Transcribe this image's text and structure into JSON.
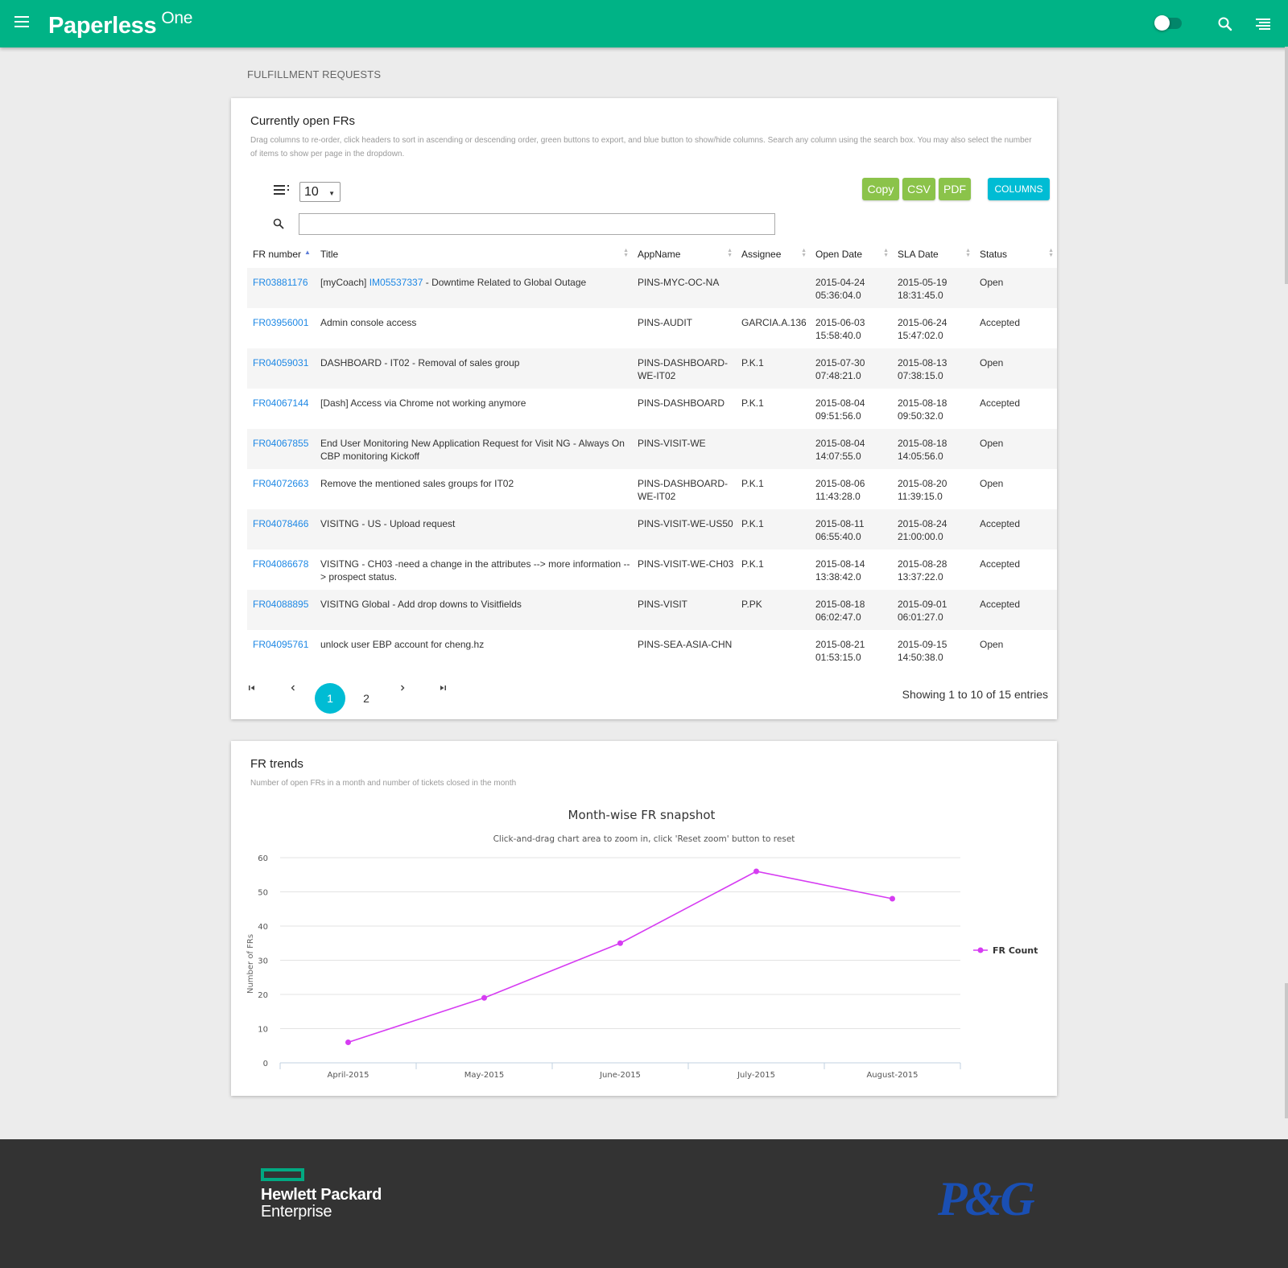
{
  "header": {
    "brand": "Paperless",
    "brand_suffix": "One",
    "icons": [
      "menu-icon",
      "toggle-switch",
      "search-icon",
      "menu-right-icon"
    ]
  },
  "page_title": "FULFILLMENT REQUESTS",
  "open_frs": {
    "title": "Currently open FRs",
    "description": "Drag columns to re-order, click headers to sort in ascending or descending order, green buttons to export, and blue button to show/hide columns. Search any column using the search box. You may also select the number of items to show per page in the dropdown.",
    "page_length": "10",
    "buttons": {
      "copy": "Copy",
      "csv": "CSV",
      "pdf": "PDF",
      "columns": "COLUMNS"
    },
    "search_value": "",
    "columns": [
      "FR number",
      "Title",
      "AppName",
      "Assignee",
      "Open Date",
      "SLA Date",
      "Status"
    ],
    "rows": [
      {
        "fr": "FR03881176",
        "title_prefix": "[myCoach] ",
        "title_link": "IM05537337",
        "title_suffix": " - Downtime Related to Global Outage",
        "app": "PINS-MYC-OC-NA",
        "assignee": "",
        "open_date": "2015-04-24",
        "open_time": "05:36:04.0",
        "sla_date": "2015-05-19",
        "sla_time": "18:31:45.0",
        "status": "Open"
      },
      {
        "fr": "FR03956001",
        "title_prefix": "Admin console access",
        "title_link": "",
        "title_suffix": "",
        "app": "PINS-AUDIT",
        "assignee": "GARCIA.A.136",
        "open_date": "2015-06-03",
        "open_time": "15:58:40.0",
        "sla_date": "2015-06-24",
        "sla_time": "15:47:02.0",
        "status": "Accepted"
      },
      {
        "fr": "FR04059031",
        "title_prefix": "DASHBOARD - IT02 - Removal of sales group",
        "title_link": "",
        "title_suffix": "",
        "app": "PINS-DASHBOARD-WE-IT02",
        "assignee": "P.K.1",
        "open_date": "2015-07-30",
        "open_time": "07:48:21.0",
        "sla_date": "2015-08-13",
        "sla_time": "07:38:15.0",
        "status": "Open"
      },
      {
        "fr": "FR04067144",
        "title_prefix": "[Dash] Access via Chrome not working anymore",
        "title_link": "",
        "title_suffix": "",
        "app": "PINS-DASHBOARD",
        "assignee": "P.K.1",
        "open_date": "2015-08-04",
        "open_time": "09:51:56.0",
        "sla_date": "2015-08-18",
        "sla_time": "09:50:32.0",
        "status": "Accepted"
      },
      {
        "fr": "FR04067855",
        "title_prefix": "End User Monitoring New Application Request for Visit NG - Always On CBP monitoring Kickoff",
        "title_link": "",
        "title_suffix": "",
        "app": "PINS-VISIT-WE",
        "assignee": "",
        "open_date": "2015-08-04",
        "open_time": "14:07:55.0",
        "sla_date": "2015-08-18",
        "sla_time": "14:05:56.0",
        "status": "Open"
      },
      {
        "fr": "FR04072663",
        "title_prefix": "Remove the mentioned sales groups for IT02",
        "title_link": "",
        "title_suffix": "",
        "app": "PINS-DASHBOARD-WE-IT02",
        "assignee": "P.K.1",
        "open_date": "2015-08-06",
        "open_time": "11:43:28.0",
        "sla_date": "2015-08-20",
        "sla_time": "11:39:15.0",
        "status": "Open"
      },
      {
        "fr": "FR04078466",
        "title_prefix": "VISITNG - US - Upload request",
        "title_link": "",
        "title_suffix": "",
        "app": "PINS-VISIT-WE-US50",
        "assignee": "P.K.1",
        "open_date": "2015-08-11",
        "open_time": "06:55:40.0",
        "sla_date": "2015-08-24",
        "sla_time": "21:00:00.0",
        "status": "Accepted"
      },
      {
        "fr": "FR04086678",
        "title_prefix": "VISITNG - CH03 -need a change in the attributes --> more information --> prospect status.",
        "title_link": "",
        "title_suffix": "",
        "app": "PINS-VISIT-WE-CH03",
        "assignee": "P.K.1",
        "open_date": "2015-08-14",
        "open_time": "13:38:42.0",
        "sla_date": "2015-08-28",
        "sla_time": "13:37:22.0",
        "status": "Accepted"
      },
      {
        "fr": "FR04088895",
        "title_prefix": "VISITNG Global - Add drop downs to Visitfields",
        "title_link": "",
        "title_suffix": "",
        "app": "PINS-VISIT",
        "assignee": "P.PK",
        "open_date": "2015-08-18",
        "open_time": "06:02:47.0",
        "sla_date": "2015-09-01",
        "sla_time": "06:01:27.0",
        "status": "Accepted"
      },
      {
        "fr": "FR04095761",
        "title_prefix": "unlock user EBP account for cheng.hz",
        "title_link": "",
        "title_suffix": "",
        "app": "PINS-SEA-ASIA-CHN",
        "assignee": "",
        "open_date": "2015-08-21",
        "open_time": "01:53:15.0",
        "sla_date": "2015-09-15",
        "sla_time": "14:50:38.0",
        "status": "Open"
      }
    ],
    "pagination": {
      "current": "1",
      "next_page": "2",
      "info": "Showing 1 to 10 of 15 entries"
    }
  },
  "trends": {
    "title": "FR trends",
    "description": "Number of open FRs in a month and number of tickets closed in the month"
  },
  "chart_data": {
    "type": "line",
    "title": "Month-wise FR snapshot",
    "subtitle": "Click-and-drag chart area to zoom in, click 'Reset zoom' button to reset",
    "xlabel": "",
    "ylabel": "Number of FRs",
    "categories": [
      "April-2015",
      "May-2015",
      "June-2015",
      "July-2015",
      "August-2015"
    ],
    "series": [
      {
        "name": "FR Count",
        "values": [
          6,
          19,
          35,
          56,
          48
        ],
        "color": "#d63cf2"
      }
    ],
    "ylim": [
      0,
      60
    ],
    "yticks": [
      0,
      10,
      20,
      30,
      40,
      50,
      60
    ],
    "grid": true,
    "legend": "right"
  },
  "footer": {
    "hpe_line1": "Hewlett Packard",
    "hpe_line2": "Enterprise",
    "pg_logo": "P&G"
  },
  "colors": {
    "header": "#00b386",
    "export_buttons": "#8bc34a",
    "columns_button": "#00bcd4",
    "link": "#1e88e5",
    "footer": "#333333"
  }
}
